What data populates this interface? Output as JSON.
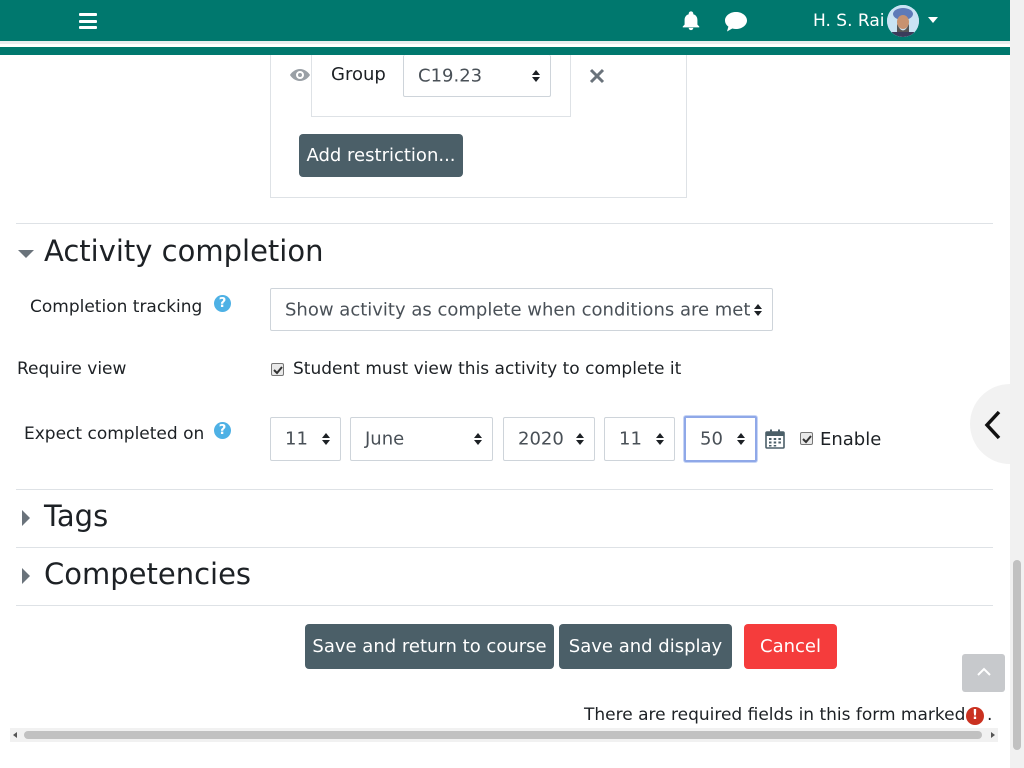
{
  "navbar": {
    "username": "H. S. Rai",
    "bg_color": "#00786e"
  },
  "restriction": {
    "group_label": "Group",
    "group_value": "C19.23",
    "add_restriction_label": "Add restriction..."
  },
  "activity_completion": {
    "title": "Activity completion",
    "completion_tracking_label": "Completion tracking",
    "completion_tracking_value": "Show activity as complete when conditions are met",
    "require_view_label": "Require view",
    "require_view_checkbox_label": "Student must view this activity to complete it",
    "require_view_checked": true,
    "expect_completed_label": "Expect completed on",
    "date": {
      "day": "11",
      "month": "June",
      "year": "2020",
      "hour": "11",
      "minute": "50"
    },
    "enable_label": "Enable",
    "enable_checked": true
  },
  "sections": {
    "tags": "Tags",
    "competencies": "Competencies"
  },
  "buttons": {
    "save_return": "Save and return to course",
    "save_display": "Save and display",
    "cancel": "Cancel"
  },
  "required_notice": "There are required fields in this form marked",
  "required_notice_end": ".",
  "icons": {
    "help": "?",
    "required": "!"
  },
  "colors": {
    "primary_dark": "#4b5f68",
    "danger": "#f53c3c",
    "help": "#4eb1e5"
  }
}
